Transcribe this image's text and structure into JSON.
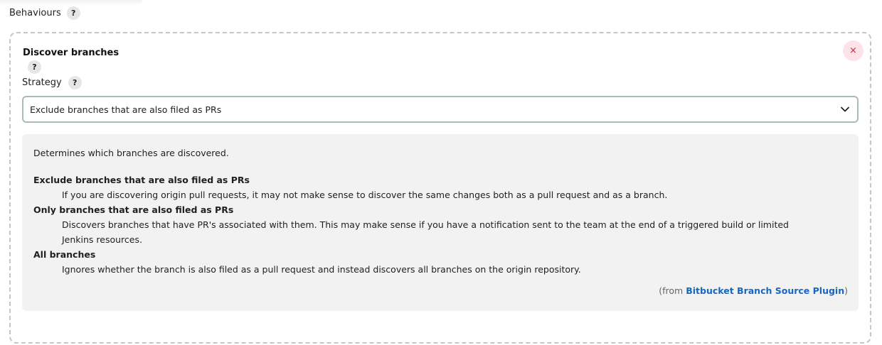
{
  "section": {
    "label": "Behaviours",
    "help_glyph": "?"
  },
  "card": {
    "title": "Discover branches",
    "help_glyph": "?",
    "close_glyph": "×",
    "accent_color": "#d0253e"
  },
  "strategy": {
    "label": "Strategy",
    "help_glyph": "?",
    "selected": "Exclude branches that are also filed as PRs"
  },
  "help": {
    "intro": "Determines which branches are discovered.",
    "options": [
      {
        "term": "Exclude branches that are also filed as PRs",
        "description": "If you are discovering origin pull requests, it may not make sense to discover the same changes both as a pull request and as a branch."
      },
      {
        "term": "Only branches that are also filed as PRs",
        "description": "Discovers branches that have PR's associated with them. This may make sense if you have a notification sent to the team at the end of a triggered build or limited Jenkins resources."
      },
      {
        "term": "All branches",
        "description": "Ignores whether the branch is also filed as a pull request and instead discovers all branches on the origin repository."
      }
    ],
    "from_prefix": "(from ",
    "plugin_link": "Bitbucket Branch Source Plugin",
    "from_suffix": ")",
    "link_color": "#1467c6"
  },
  "icons": {
    "chevron": "chevron-down-icon",
    "close": "close-icon",
    "help": "help-icon"
  }
}
